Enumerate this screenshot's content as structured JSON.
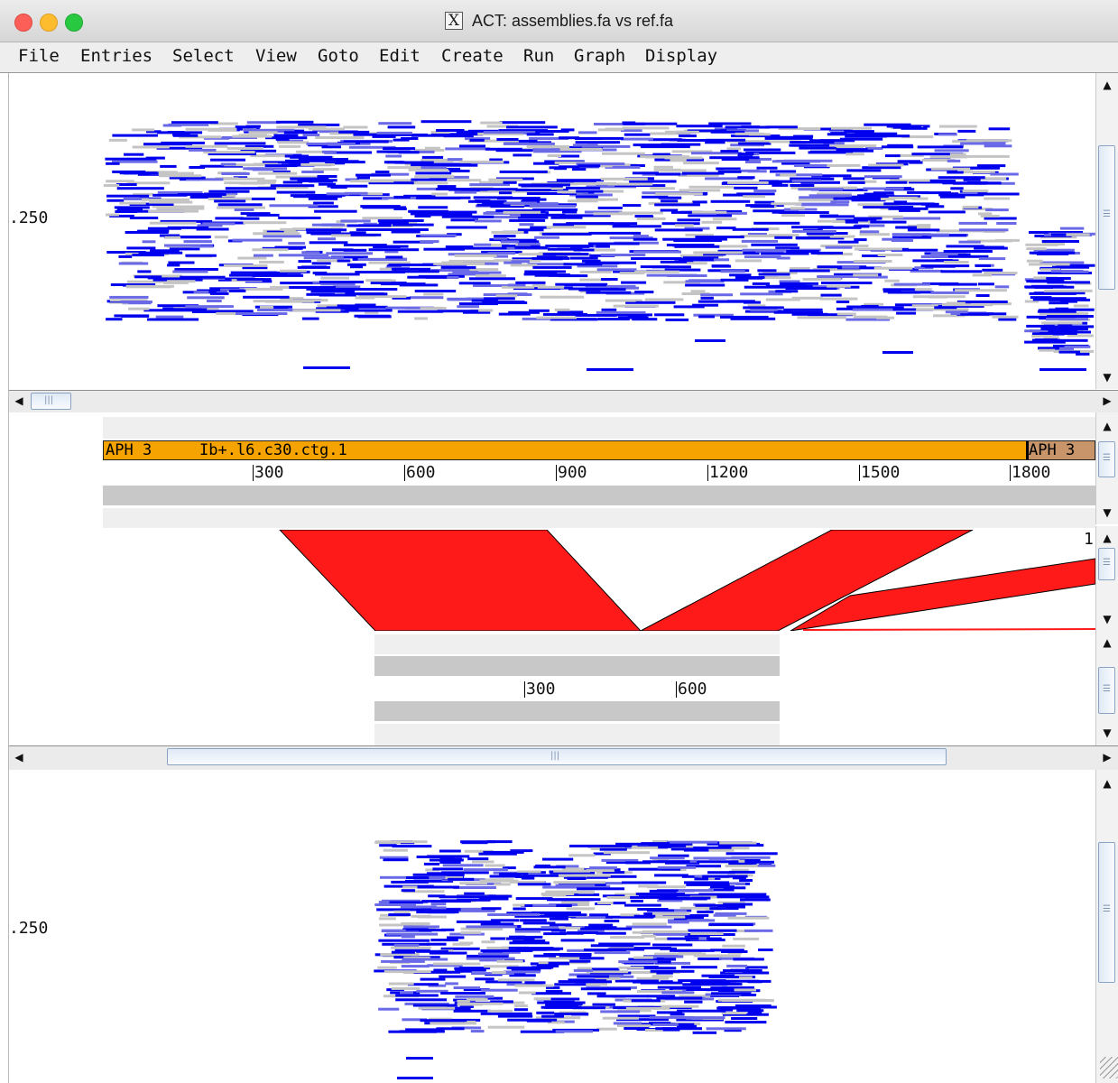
{
  "window": {
    "title": "ACT: assemblies.fa vs ref.fa",
    "x_icon": "X"
  },
  "menu": [
    "File",
    "Entries",
    "Select",
    "View",
    "Goto",
    "Edit",
    "Create",
    "Run",
    "Graph",
    "Display"
  ],
  "top_plot": {
    "y_label": ".250"
  },
  "bottom_plot": {
    "y_label": ".250"
  },
  "ref_sequence": {
    "feature_label_1": "APH 3",
    "feature_label_2": "Ib+.l6.c30.ctg.1",
    "feature_label_3": "APH 3",
    "ticks": [
      "300",
      "600",
      "900",
      "1200",
      "1500",
      "1800"
    ]
  },
  "query_sequence": {
    "ticks": [
      "300",
      "600"
    ]
  },
  "comparison": {
    "edge_label": "1"
  },
  "colors": {
    "feature": "#f5a300",
    "feature_alt": "#c8956a",
    "match": "#ff1a1a",
    "read": "#0000ee",
    "read_light": "#6a6ae8",
    "read_grey": "#c4c4c4",
    "frame_dark": "#c8c8c8",
    "frame_light": "#efefef"
  },
  "icons": [
    "close-window-icon",
    "minimize-window-icon",
    "zoom-window-icon",
    "x11-icon",
    "scroll-up-icon",
    "scroll-down-icon",
    "scroll-left-icon",
    "scroll-right-icon",
    "resize-grip-icon"
  ]
}
